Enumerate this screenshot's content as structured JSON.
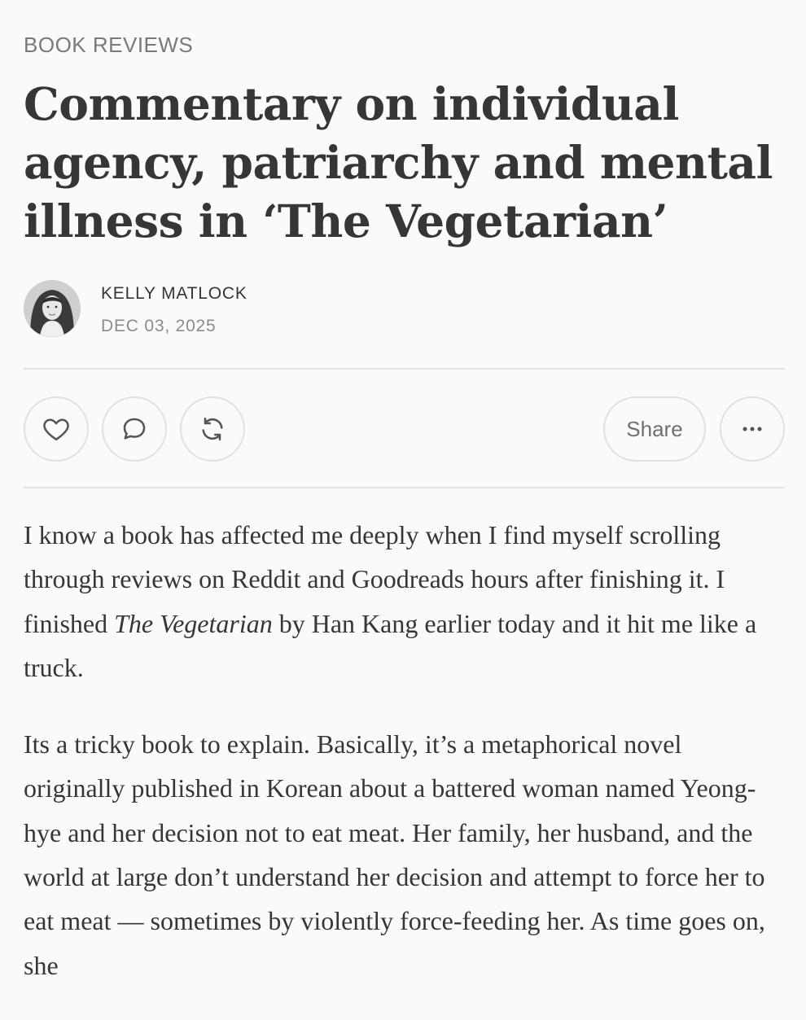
{
  "post": {
    "section": "BOOK REVIEWS",
    "title": "Commentary on individual agency, patriarchy and mental illness in ‘The Vegetarian’",
    "author": "KELLY MATLOCK",
    "date": "DEC 03, 2025"
  },
  "actions": {
    "like_icon": "heart-icon",
    "comment_icon": "comment-bubble-icon",
    "restack_icon": "restack-icon",
    "share_label": "Share",
    "more_icon": "ellipsis-icon"
  },
  "body": {
    "p1_before": "I know a book has affected me deeply when I find myself scrolling through reviews on Reddit and Goodreads hours after finishing it. I finished ",
    "p1_italic": "The Vegetarian",
    "p1_after": " by Han Kang earlier today and it hit me like a truck.",
    "p2": "Its a tricky book to explain. Basically, it’s a metaphorical novel originally published in Korean about a battered woman named Yeong-hye and her decision not to eat meat. Her family, her husband, and the world at large don’t understand her decision and attempt to force her to eat meat — sometimes by violently force-feeding her. As time goes on, she"
  },
  "colors": {
    "background": "#fafafa",
    "text": "#363636",
    "muted": "#7a7a7a",
    "border": "#e0e0e0"
  }
}
